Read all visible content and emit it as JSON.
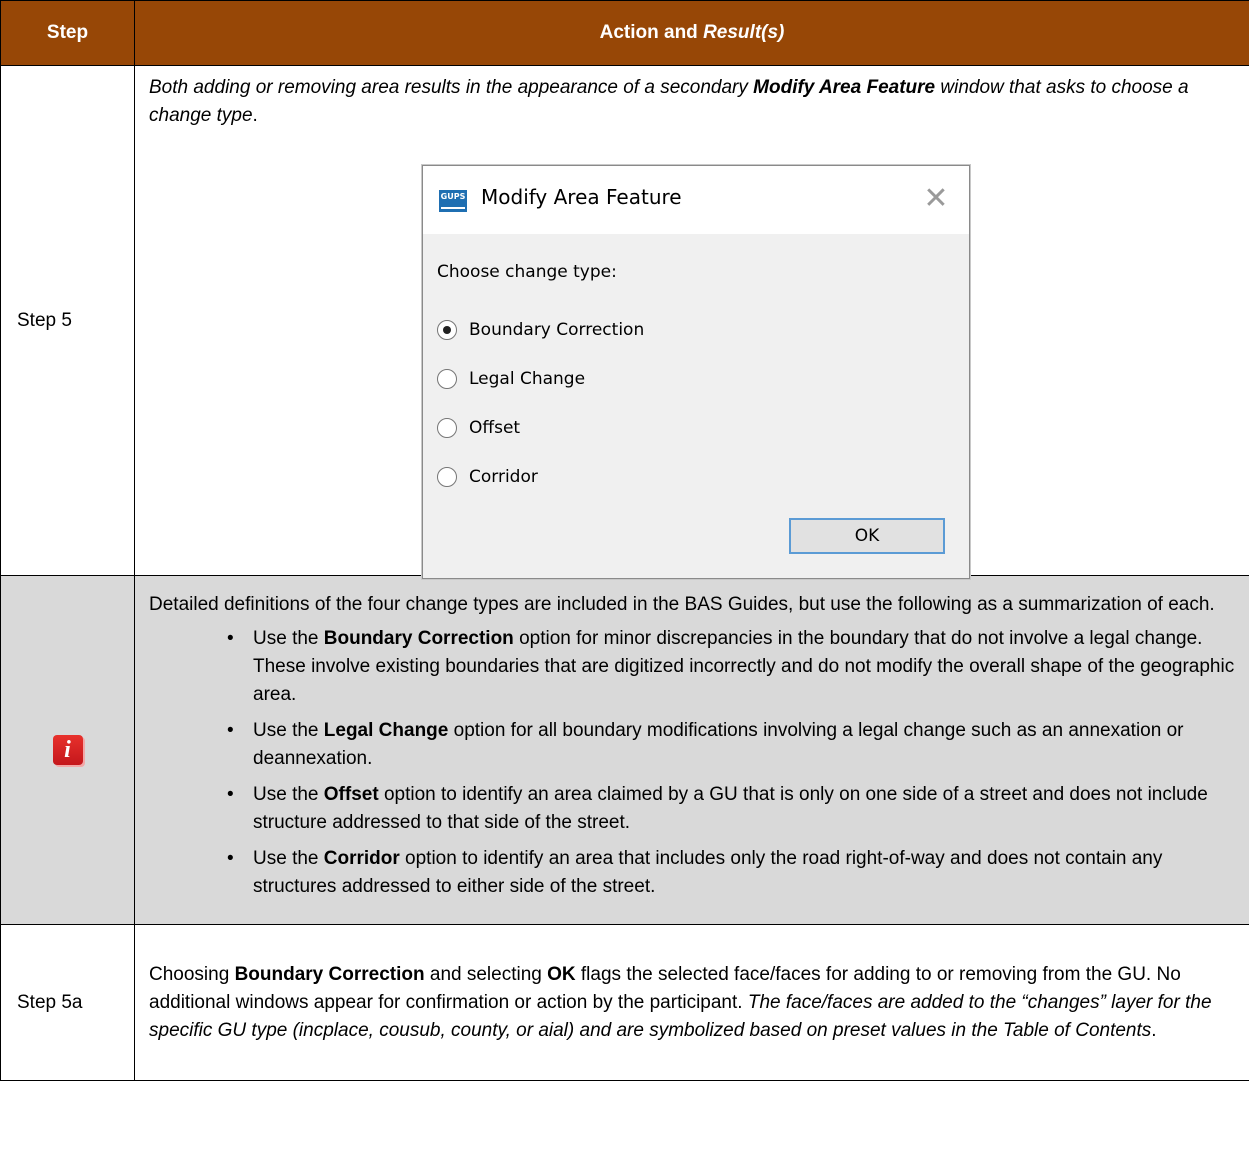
{
  "table": {
    "headers": {
      "step": "Step",
      "action_prefix": "Action and ",
      "action_italic": "Result(s)"
    },
    "row1": {
      "step": "Step 5",
      "text_a": "Both adding or removing area results in the appearance of a secondary ",
      "text_bold": "Modify Area Feature",
      "text_b": " window that asks to choose a change type",
      "text_end": "."
    },
    "note": {
      "icon": "info-icon",
      "intro": "Detailed definitions of the four change types are included in the BAS Guides, but use the following as a summarization of each.",
      "bullets": [
        {
          "pre": "Use the ",
          "bold": "Boundary Correction",
          "post": " option for minor discrepancies in the boundary that do not involve a legal change. These involve existing boundaries that are digitized incorrectly and do not modify the overall shape of the geographic area."
        },
        {
          "pre": "Use the ",
          "bold": "Legal Change",
          "post": " option for all boundary modifications involving a legal change such as an annexation or deannexation."
        },
        {
          "pre": "Use the ",
          "bold": "Offset",
          "post": " option to identify an area claimed by a GU that is only on one side of a street and does not include structure addressed to that side of the street."
        },
        {
          "pre": "Use the ",
          "bold": "Corridor",
          "post": " option to identify an area that includes only the road right-of-way and does not contain any structures addressed to either side of the street."
        }
      ]
    },
    "row3": {
      "step": "Step 5a",
      "t1": "Choosing ",
      "b1": "Boundary Correction",
      "t2": " and selecting ",
      "b2": "OK",
      "t3": " flags the selected face/faces for adding to or removing from the GU. No additional windows appear for confirmation or action by the participant. ",
      "italic": "The face/faces are added to the “changes” layer for the specific GU type (incplace, cousub, county, or aial) and are symbolized based on preset values in the Table of Contents",
      "end": "."
    }
  },
  "dialog": {
    "logo_text": "GUPS",
    "title": "Modify Area Feature",
    "close_glyph": "✕",
    "prompt": "Choose change type:",
    "options": [
      "Boundary Correction",
      "Legal Change",
      "Offset",
      "Corridor"
    ],
    "selected_index": 0,
    "ok_label": "OK"
  },
  "colors": {
    "header_bg": "#974706",
    "note_bg": "#d9d9d9",
    "info_icon": "#d32027"
  }
}
